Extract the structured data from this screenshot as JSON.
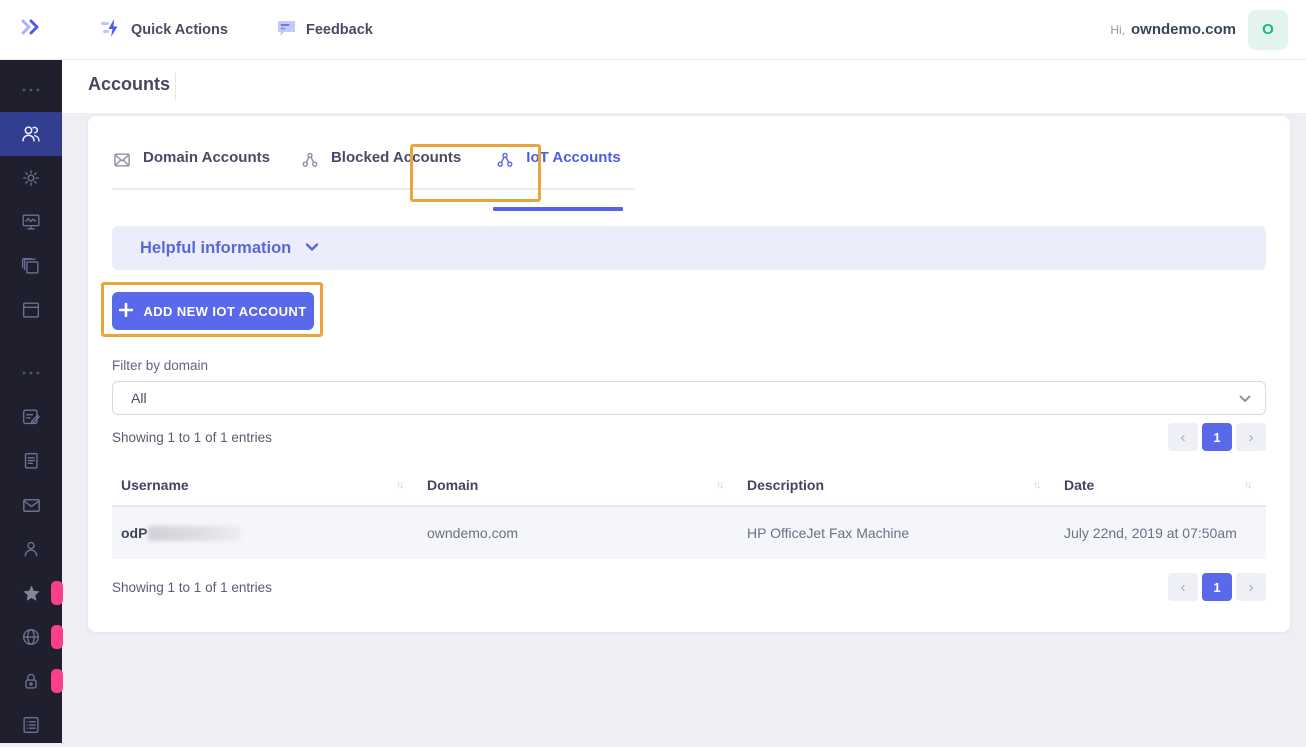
{
  "topbar": {
    "collapse_icon": "double-chevron-right",
    "quick_actions_label": "Quick Actions",
    "feedback_label": "Feedback",
    "greeting": "Hi,",
    "account_name": "owndemo.com",
    "avatar_letter": "O"
  },
  "page_title": "Accounts",
  "sidebar": {
    "icons": [
      "ellipsis",
      "users",
      "gear",
      "monitor-chart",
      "copies",
      "window",
      "ellipsis",
      "note-edit",
      "document",
      "envelope",
      "user",
      "star",
      "globe",
      "lock",
      "list"
    ],
    "active_icon": "users",
    "badged_icons": [
      "star",
      "globe",
      "lock"
    ]
  },
  "tabs": {
    "items": [
      {
        "icon": "envelope-icon",
        "label": "Domain Accounts",
        "active": false
      },
      {
        "icon": "iot-network-icon",
        "label": "Blocked Accounts",
        "active": false
      },
      {
        "icon": "iot-network-icon",
        "label": "IoT Accounts",
        "active": true
      }
    ]
  },
  "helpful": {
    "title": "Helpful information",
    "chevron": "chevron-down-icon"
  },
  "add_button": {
    "label": "ADD NEW IOT ACCOUNT",
    "icon": "plus-icon"
  },
  "filter": {
    "label": "Filter by domain",
    "selected_value": "All"
  },
  "entries_summary": "Showing 1 to 1 of 1 entries",
  "table": {
    "columns": [
      {
        "label": "Username"
      },
      {
        "label": "Domain"
      },
      {
        "label": "Description"
      },
      {
        "label": "Date"
      }
    ],
    "rows": [
      {
        "username_visible": "odP",
        "username_redacted": true,
        "domain": "owndemo.com",
        "description": "HP OfficeJet Fax Machine",
        "date": "July 22nd, 2019 at 07:50am"
      }
    ]
  },
  "pagination": {
    "prev": "‹",
    "current_page": "1",
    "next": "›"
  },
  "annotations": [
    {
      "target": "iot-accounts-tab"
    },
    {
      "target": "add-new-iot-account-button"
    }
  ],
  "colors": {
    "accent_blue": "#5a68ea",
    "active_tab_text": "#4d5ee3",
    "annotation_orange": "#eba63b",
    "sidebar_bg": "#201f2d",
    "sidebar_active_bg": "#333e90",
    "badge_pink": "#fd3e8d",
    "avatar_green": "#18b48e",
    "helpful_bg": "#ebedfa",
    "row_bg": "#f5f6fa"
  }
}
